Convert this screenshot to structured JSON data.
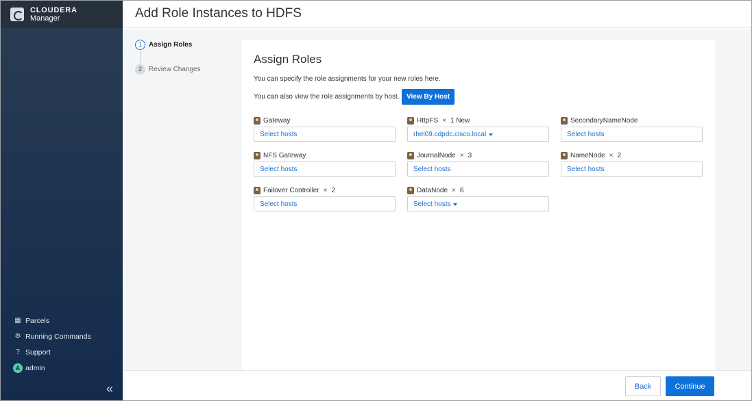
{
  "brand": {
    "name": "CLOUDERA",
    "subtitle": "Manager",
    "logo_icon": "cloudera-logo-icon"
  },
  "sidebar": {
    "items": [
      {
        "label": "Parcels",
        "icon": "parcels-icon",
        "glyph": "▦"
      },
      {
        "label": "Running Commands",
        "icon": "running-commands-icon",
        "glyph": "⚙"
      },
      {
        "label": "Support",
        "icon": "support-icon",
        "glyph": "?"
      },
      {
        "label": "admin",
        "icon": "user-avatar",
        "avatar_letter": "A"
      }
    ],
    "collapse_glyph": "«"
  },
  "header": {
    "title": "Add Role Instances to HDFS"
  },
  "steps": [
    {
      "number": "1",
      "label": "Assign Roles",
      "active": true
    },
    {
      "number": "2",
      "label": "Review Changes",
      "active": false
    }
  ],
  "card": {
    "title": "Assign Roles",
    "description": "You can specify the role assignments for your new roles here.",
    "host_view_text": "You can also view the role assignments by host.",
    "view_by_host_label": "View By Host"
  },
  "roles": [
    {
      "name": "Gateway",
      "count": "",
      "value": "Select hosts",
      "dropdown": false
    },
    {
      "name": "HttpFS",
      "count": "1 New",
      "value": "rhel09.cdpdc.cisco.local",
      "dropdown": true
    },
    {
      "name": "SecondaryNameNode",
      "count": "",
      "value": "Select hosts",
      "dropdown": false
    },
    {
      "name": "NFS Gateway",
      "count": "",
      "value": "Select hosts",
      "dropdown": false
    },
    {
      "name": "JournalNode",
      "count": "3",
      "value": "Select hosts",
      "dropdown": false
    },
    {
      "name": "NameNode",
      "count": "2",
      "value": "Select hosts",
      "dropdown": false
    },
    {
      "name": "Failover Controller",
      "count": "2",
      "value": "Select hosts",
      "dropdown": false
    },
    {
      "name": "DataNode",
      "count": "6",
      "value": "Select hosts",
      "dropdown": true
    }
  ],
  "footer": {
    "back_label": "Back",
    "continue_label": "Continue"
  },
  "colors": {
    "primary": "#1070d9",
    "link": "#1a6ed0",
    "sidebar_top": "#2a3d52",
    "sidebar_bottom": "#142b4d",
    "avatar": "#4fd1a8"
  }
}
